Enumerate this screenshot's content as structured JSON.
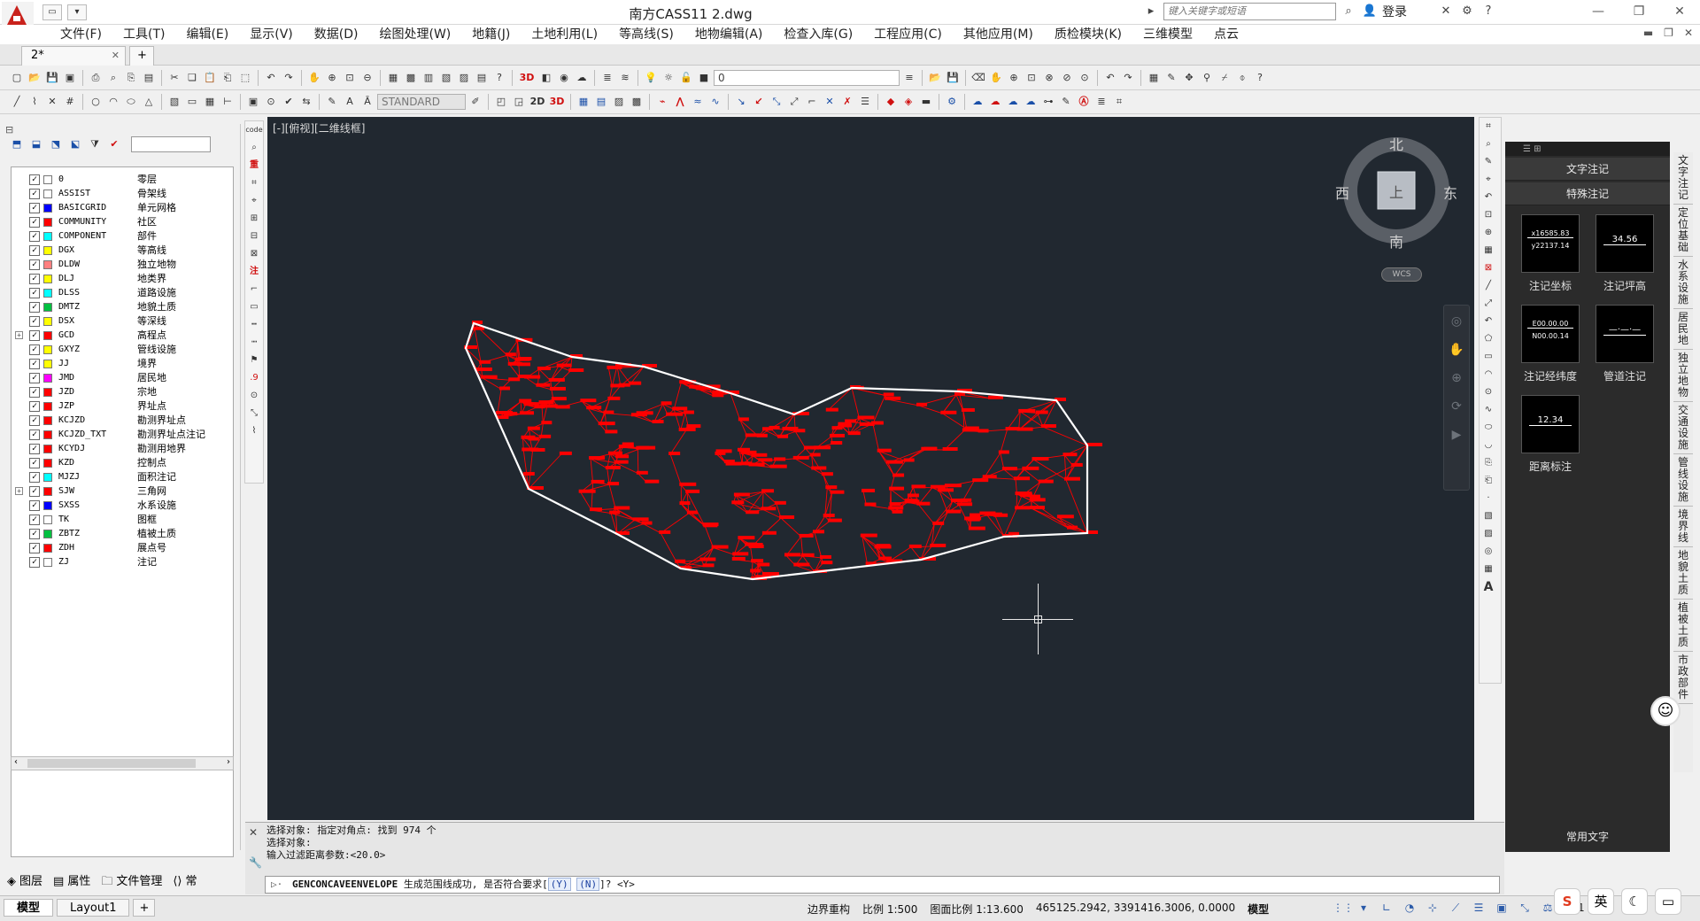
{
  "window": {
    "title": "南方CASS11    2.dwg",
    "search_placeholder": "键入关键字或短语",
    "login": "登录"
  },
  "menus": [
    "文件(F)",
    "工具(T)",
    "编辑(E)",
    "显示(V)",
    "数据(D)",
    "绘图处理(W)",
    "地籍(J)",
    "土地利用(L)",
    "等高线(S)",
    "地物编辑(A)",
    "检查入库(G)",
    "工程应用(C)",
    "其他应用(M)",
    "质检模块(K)",
    "三维模型",
    "点云"
  ],
  "doc_tabs": {
    "active": "2*",
    "new_tab": "+"
  },
  "toolbar": {
    "layer_value": "0",
    "text_style": "STANDARD",
    "toggle_3d": "3D",
    "toggle_2d": "2D"
  },
  "layers": [
    {
      "name": "0",
      "desc": "零层",
      "color": "#ffffff",
      "expand": false
    },
    {
      "name": "ASSIST",
      "desc": "骨架线",
      "color": "#ffffff",
      "expand": false
    },
    {
      "name": "BASICGRID",
      "desc": "单元网格",
      "color": "#0000ff",
      "expand": false
    },
    {
      "name": "COMMUNITY",
      "desc": "社区",
      "color": "#ff0000",
      "expand": false
    },
    {
      "name": "COMPONENT",
      "desc": "部件",
      "color": "#00ffff",
      "expand": false
    },
    {
      "name": "DGX",
      "desc": "等高线",
      "color": "#ffff00",
      "expand": false
    },
    {
      "name": "DLDW",
      "desc": "独立地物",
      "color": "#ff8080",
      "expand": false
    },
    {
      "name": "DLJ",
      "desc": "地类界",
      "color": "#ffff00",
      "expand": false
    },
    {
      "name": "DLSS",
      "desc": "道路设施",
      "color": "#00ffff",
      "expand": false
    },
    {
      "name": "DMTZ",
      "desc": "地貌土质",
      "color": "#00c040",
      "expand": false
    },
    {
      "name": "DSX",
      "desc": "等深线",
      "color": "#ffff00",
      "expand": false
    },
    {
      "name": "GCD",
      "desc": "高程点",
      "color": "#ff0000",
      "expand": true
    },
    {
      "name": "GXYZ",
      "desc": "管线设施",
      "color": "#ffff00",
      "expand": false
    },
    {
      "name": "JJ",
      "desc": "境界",
      "color": "#ffff00",
      "expand": false
    },
    {
      "name": "JMD",
      "desc": "居民地",
      "color": "#ff00ff",
      "expand": false
    },
    {
      "name": "JZD",
      "desc": "宗地",
      "color": "#ff0000",
      "expand": false
    },
    {
      "name": "JZP",
      "desc": "界址点",
      "color": "#ff0000",
      "expand": false
    },
    {
      "name": "KCJZD",
      "desc": "勘测界址点",
      "color": "#ff0000",
      "expand": false
    },
    {
      "name": "KCJZD_TXT",
      "desc": "勘测界址点注记",
      "color": "#ff0000",
      "expand": false
    },
    {
      "name": "KCYDJ",
      "desc": "勘测用地界",
      "color": "#ff0000",
      "expand": false
    },
    {
      "name": "KZD",
      "desc": "控制点",
      "color": "#ff0000",
      "expand": false
    },
    {
      "name": "MJZJ",
      "desc": "面积注记",
      "color": "#00ffff",
      "expand": false
    },
    {
      "name": "SJW",
      "desc": "三角网",
      "color": "#ff0000",
      "expand": true
    },
    {
      "name": "SXSS",
      "desc": "水系设施",
      "color": "#0000ff",
      "expand": false
    },
    {
      "name": "TK",
      "desc": "图框",
      "color": "#ffffff",
      "expand": false
    },
    {
      "name": "ZBTZ",
      "desc": "植被土质",
      "color": "#00c040",
      "expand": false
    },
    {
      "name": "ZDH",
      "desc": "展点号",
      "color": "#ff0000",
      "expand": false
    },
    {
      "name": "ZJ",
      "desc": "注记",
      "color": "#ffffff",
      "expand": false
    }
  ],
  "panel_tabs": [
    "图层",
    "属性",
    "文件管理",
    "常"
  ],
  "canvas": {
    "view_label": "[-][俯视][二维线框]",
    "compass": {
      "n": "北",
      "s": "南",
      "e": "东",
      "w": "西",
      "top": "上",
      "ucs": "WCS"
    }
  },
  "annotation": {
    "header1": "文字注记",
    "header2": "特殊注记",
    "tiles": [
      {
        "caption": "注记坐标",
        "lines": [
          "x16585.83",
          "y22137.14"
        ]
      },
      {
        "caption": "注记坪高",
        "lines": [
          "34.56"
        ]
      },
      {
        "caption": "注记经纬度",
        "lines": [
          "E00.00.00",
          "N00.00.14"
        ]
      },
      {
        "caption": "管道注记",
        "lines": [
          "—·—·—"
        ]
      },
      {
        "caption": "距离标注",
        "lines": [
          "12.34"
        ]
      }
    ],
    "footer": "常用文字",
    "vertical_tabs": [
      "文字注记",
      "定位基础",
      "水系设施",
      "居民地",
      "独立地物",
      "交通设施",
      "管线设施",
      "境界线",
      "地貌土质",
      "植被土质",
      "市政部件"
    ]
  },
  "command": {
    "history": [
      "选择对象: 指定对角点: 找到 974 个",
      "选择对象:",
      "输入过滤距离参数:<20.0>"
    ],
    "prompt_cmd": "GENCONCAVEENVELOPE",
    "prompt_text": "生成范围线成功, 是否符合要求[",
    "opt_y": "(Y)",
    "opt_n": "(N)",
    "prompt_tail": "]? <Y>"
  },
  "status": {
    "model_tab": "模型",
    "layout_tab": "Layout1",
    "mode": "边界重构",
    "scale": "比例 1:500",
    "paper_scale": "图面比例 1:13.600",
    "coords": "465125.2942, 3391416.3006, 0.0000",
    "space": "模型",
    "zoom": "1:1"
  },
  "colors": {
    "accent_red": "#ff0000",
    "canvas_bg": "#212830",
    "boundary": "#ffffff"
  }
}
